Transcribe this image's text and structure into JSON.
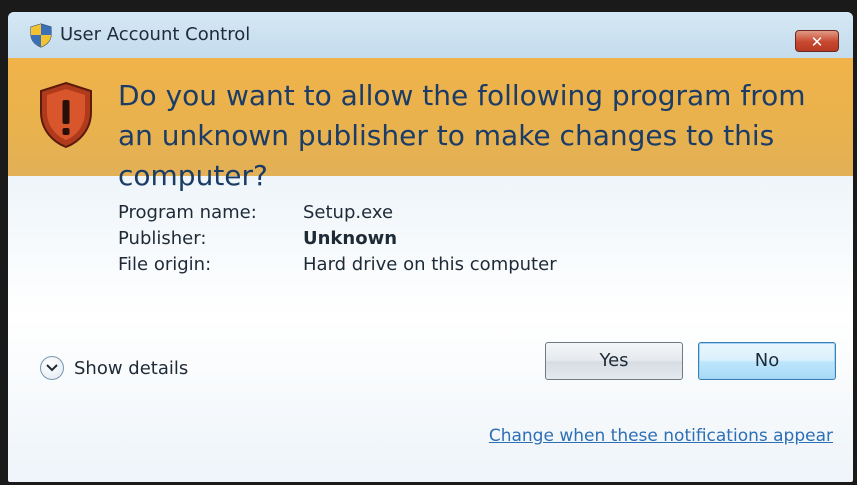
{
  "window": {
    "title": "User Account Control",
    "close_label": "✕"
  },
  "banner": {
    "question": "Do you want to allow the following program from an unknown publisher to make changes to this computer?"
  },
  "info": {
    "program_name_label": "Program name:",
    "program_name_value": "Setup.exe",
    "publisher_label": "Publisher:",
    "publisher_value": "Unknown",
    "file_origin_label": "File origin:",
    "file_origin_value": "Hard drive on this computer"
  },
  "footer": {
    "show_details_label": "Show details",
    "yes_label": "Yes",
    "no_label": "No",
    "change_link": "Change when these notifications appear"
  },
  "icons": {
    "title": "uac-shield-icon",
    "banner": "warning-shield-icon",
    "details": "chevron-down-icon"
  },
  "colors": {
    "banner": "#eab24c",
    "question_text": "#1b3c66",
    "link": "#2d6fb4",
    "close_button": "#c8472f"
  }
}
